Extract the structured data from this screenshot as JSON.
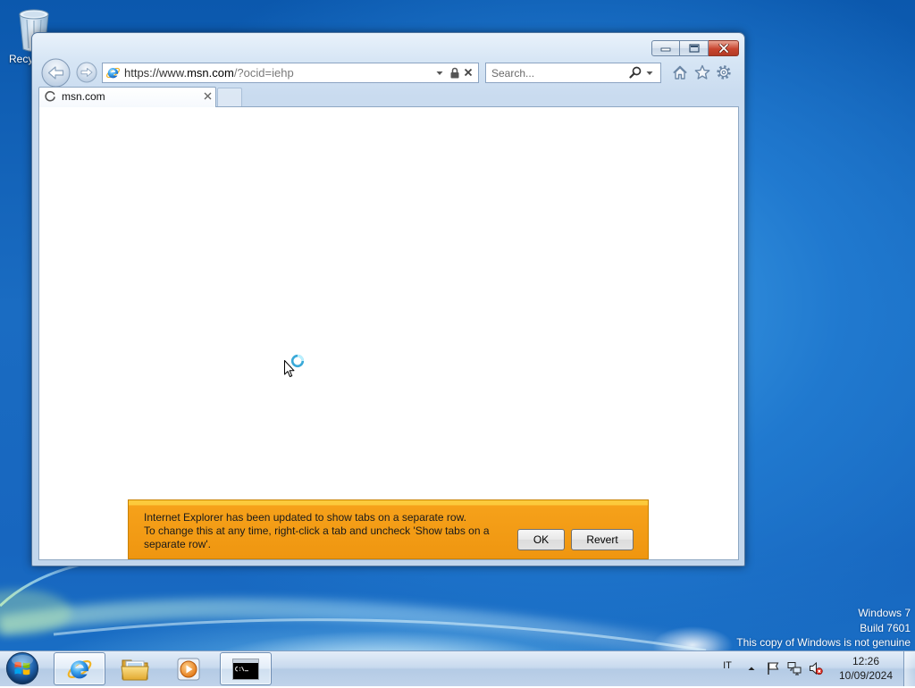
{
  "desktop": {
    "recycle_bin": {
      "label": "Recy",
      "icon": "recycle-bin-icon"
    },
    "watermark": {
      "line1": "Windows 7",
      "line2": "Build 7601",
      "line3": "This copy of Windows is not genuine"
    }
  },
  "browser": {
    "caption_icons": {
      "minimize": "minimize-icon",
      "maximize": "maximize-icon",
      "close": "close-icon"
    },
    "navigation_icons": {
      "back": "back-arrow-icon",
      "forward": "forward-arrow-icon"
    },
    "address_bar": {
      "site_icon": "internet-explorer-icon",
      "url_prefix": "https://www.",
      "url_domain": "msn.com",
      "url_path": "/?ocid=iehp",
      "icons": [
        "dropdown-arrow-icon",
        "lock-icon",
        "stop-icon"
      ]
    },
    "search_box": {
      "placeholder": "Search...",
      "icons": [
        "search-icon",
        "dropdown-arrow-icon"
      ]
    },
    "toolbar_icons": [
      "home-icon",
      "favorites-star-icon",
      "tools-gear-icon"
    ],
    "tabs": [
      {
        "title": "msn.com",
        "icon": "loading-spinner-icon"
      }
    ],
    "notification": {
      "lines": [
        "Internet Explorer has been updated to show tabs on a separate row.",
        "To change this at any time, right-click a tab and uncheck 'Show tabs on a",
        "separate row'."
      ],
      "ok_label": "OK",
      "revert_label": "Revert"
    }
  },
  "cursor": {
    "icon": "busy-cursor-icon"
  },
  "taskbar": {
    "start_icon": "windows-start-orb-icon",
    "pinned": [
      {
        "icon": "internet-explorer-icon",
        "active": true
      },
      {
        "icon": "windows-explorer-folder-icon",
        "active": false
      },
      {
        "icon": "windows-media-player-icon",
        "active": false
      },
      {
        "icon": "command-prompt-icon",
        "active": true
      }
    ],
    "tray": {
      "language": "IT",
      "icons": [
        "show-hidden-icons-icon",
        "action-center-flag-icon",
        "network-icon",
        "volume-muted-icon"
      ]
    },
    "clock": {
      "time": "12:26",
      "date": "10/09/2024"
    }
  },
  "colors": {
    "desktop_blue": "#1a6cc2",
    "window_frame": "#c9dbef",
    "notification_bar": "#f6a11a",
    "close_button": "#c8452f"
  }
}
